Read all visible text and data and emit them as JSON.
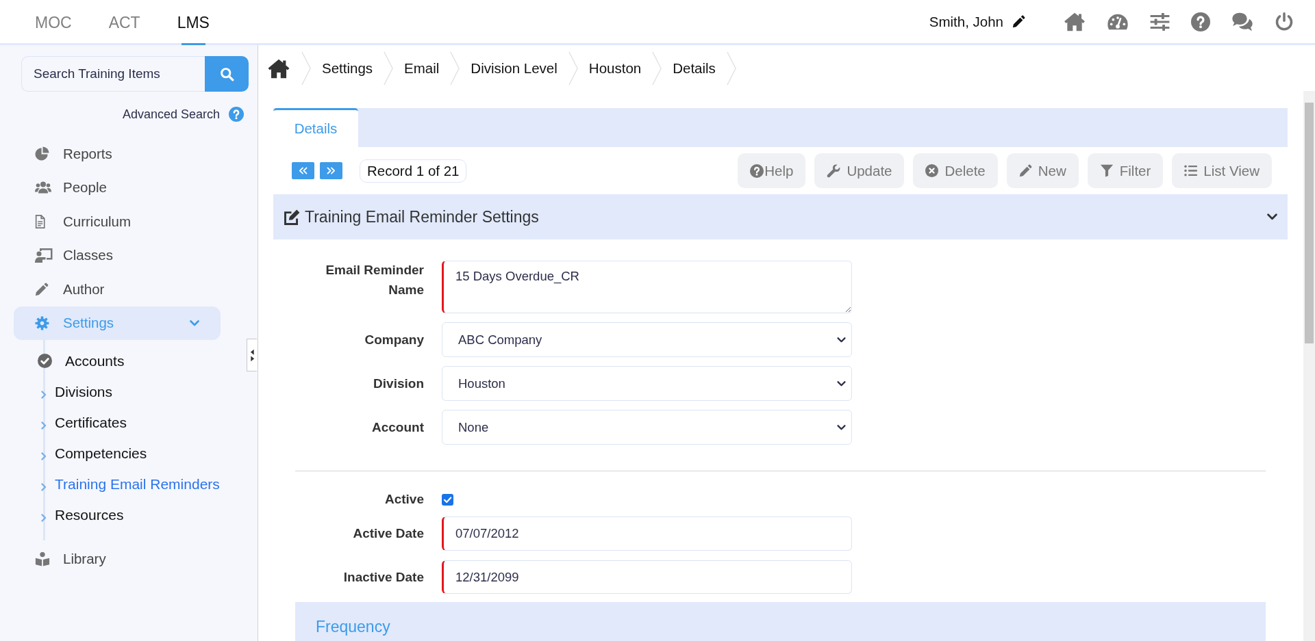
{
  "top_nav": {
    "modules": [
      {
        "label": "MOC",
        "selected": false
      },
      {
        "label": "ACT",
        "selected": false
      },
      {
        "label": "LMS",
        "selected": true
      }
    ],
    "user": "Smith, John"
  },
  "sidebar": {
    "search": {
      "placeholder": "Search Training Items"
    },
    "advanced_search": "Advanced Search",
    "items": [
      {
        "label": "Reports",
        "selected": false,
        "expanded": false
      },
      {
        "label": "People",
        "selected": false,
        "expanded": false
      },
      {
        "label": "Curriculum",
        "selected": false,
        "expanded": false
      },
      {
        "label": "Classes",
        "selected": false,
        "expanded": false
      },
      {
        "label": "Author",
        "selected": false,
        "expanded": false
      },
      {
        "label": "Settings",
        "selected": true,
        "expanded": true,
        "children": [
          {
            "label": "Accounts",
            "checked": true,
            "selected": false
          },
          {
            "label": "Divisions",
            "checked": false,
            "selected": false
          },
          {
            "label": "Certificates",
            "checked": false,
            "selected": false
          },
          {
            "label": "Competencies",
            "checked": false,
            "selected": false
          },
          {
            "label": "Training Email Reminders",
            "checked": false,
            "selected": true
          },
          {
            "label": "Resources",
            "checked": false,
            "selected": false
          }
        ]
      },
      {
        "label": "Library",
        "selected": false,
        "expanded": false
      }
    ]
  },
  "breadcrumb": [
    "Settings",
    "Email",
    "Division Level",
    "Houston",
    "Details"
  ],
  "tabs": [
    {
      "label": "Details",
      "selected": true
    }
  ],
  "record_nav": {
    "counter": "Record 1 of 21"
  },
  "toolbar": [
    "Help",
    "Update",
    "Delete",
    "New",
    "Filter",
    "List View"
  ],
  "form": {
    "title": "Training Email Reminder Settings",
    "expanded": true,
    "fields": [
      {
        "label": "Email Reminder Name",
        "kind": "textarea",
        "value": "15 Days Overdue_CR",
        "required": true
      },
      {
        "label": "Company",
        "kind": "select",
        "value": "ABC Company",
        "required": false
      },
      {
        "label": "Division",
        "kind": "select",
        "value": "Houston",
        "required": false
      },
      {
        "label": "Account",
        "kind": "select",
        "value": "None",
        "required": false
      }
    ],
    "status_fields": [
      {
        "label": "Active",
        "kind": "checkbox",
        "checked": true
      },
      {
        "label": "Active Date",
        "kind": "date",
        "value": "07/07/2012",
        "required": true
      },
      {
        "label": "Inactive Date",
        "kind": "date",
        "value": "12/31/2099",
        "required": true
      }
    ]
  },
  "frequency": {
    "title": "Frequency"
  }
}
